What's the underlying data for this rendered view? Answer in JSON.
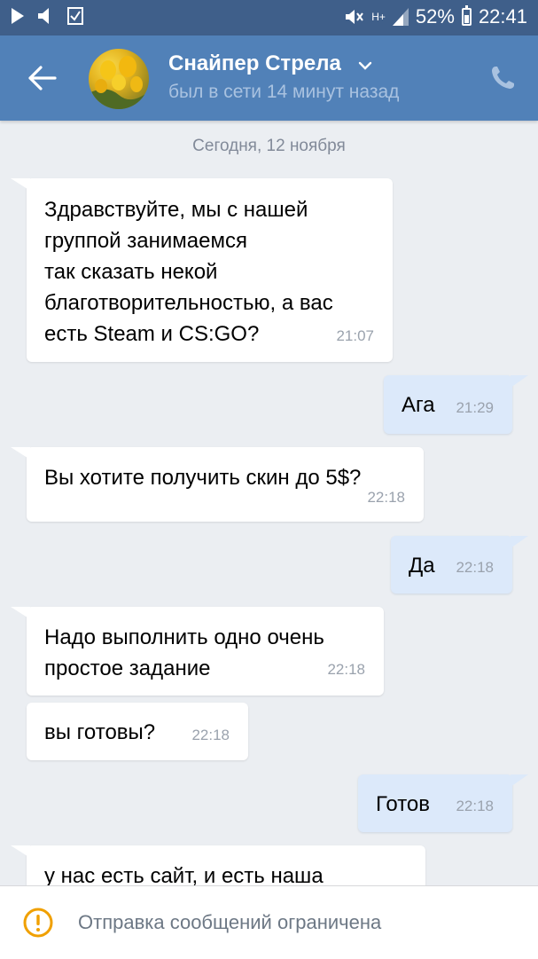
{
  "status_bar": {
    "network_label": "H+",
    "battery": "52%",
    "time": "22:41"
  },
  "header": {
    "name": "Снайпер Стрела",
    "status": "был в сети 14 минут назад"
  },
  "chat": {
    "date": "Сегодня, 12 ноября",
    "messages": [
      {
        "dir": "in",
        "text": "Здравствуйте, мы с нашей\nгруппой занимаемся\nтак сказать некой\nблаготворительностью, а вас\nесть Steam и CS:GO?",
        "time": "21:07"
      },
      {
        "dir": "out",
        "text": "Ага",
        "time": "21:29"
      },
      {
        "dir": "in",
        "text": "Вы хотите получить скин до 5$?",
        "time": "22:18"
      },
      {
        "dir": "out",
        "text": "Да",
        "time": "22:18"
      },
      {
        "dir": "in",
        "text": "Надо выполнить одно очень\nпростое задание",
        "time": "22:18"
      },
      {
        "dir": "in",
        "text": "вы готовы?",
        "time": "22:18"
      },
      {
        "dir": "out",
        "text": "Готов",
        "time": "22:18"
      },
      {
        "dir": "in",
        "text": "у нас есть сайт, и есть наша",
        "time": ""
      }
    ]
  },
  "bottom_bar": {
    "notice": "Отправка сообщений ограничена"
  },
  "colors": {
    "status_bar": "#3f5f8a",
    "header": "#5181b8",
    "chat_bg": "#ebeef2",
    "incoming_bubble": "#ffffff",
    "outgoing_bubble": "#dce9fa",
    "warning": "#f0a000"
  },
  "icons": [
    "play-icon",
    "volume-icon",
    "checkbox-icon",
    "mute-icon",
    "signal-icon",
    "battery-icon",
    "back-arrow-icon",
    "chevron-down-icon",
    "phone-icon",
    "warning-icon"
  ]
}
